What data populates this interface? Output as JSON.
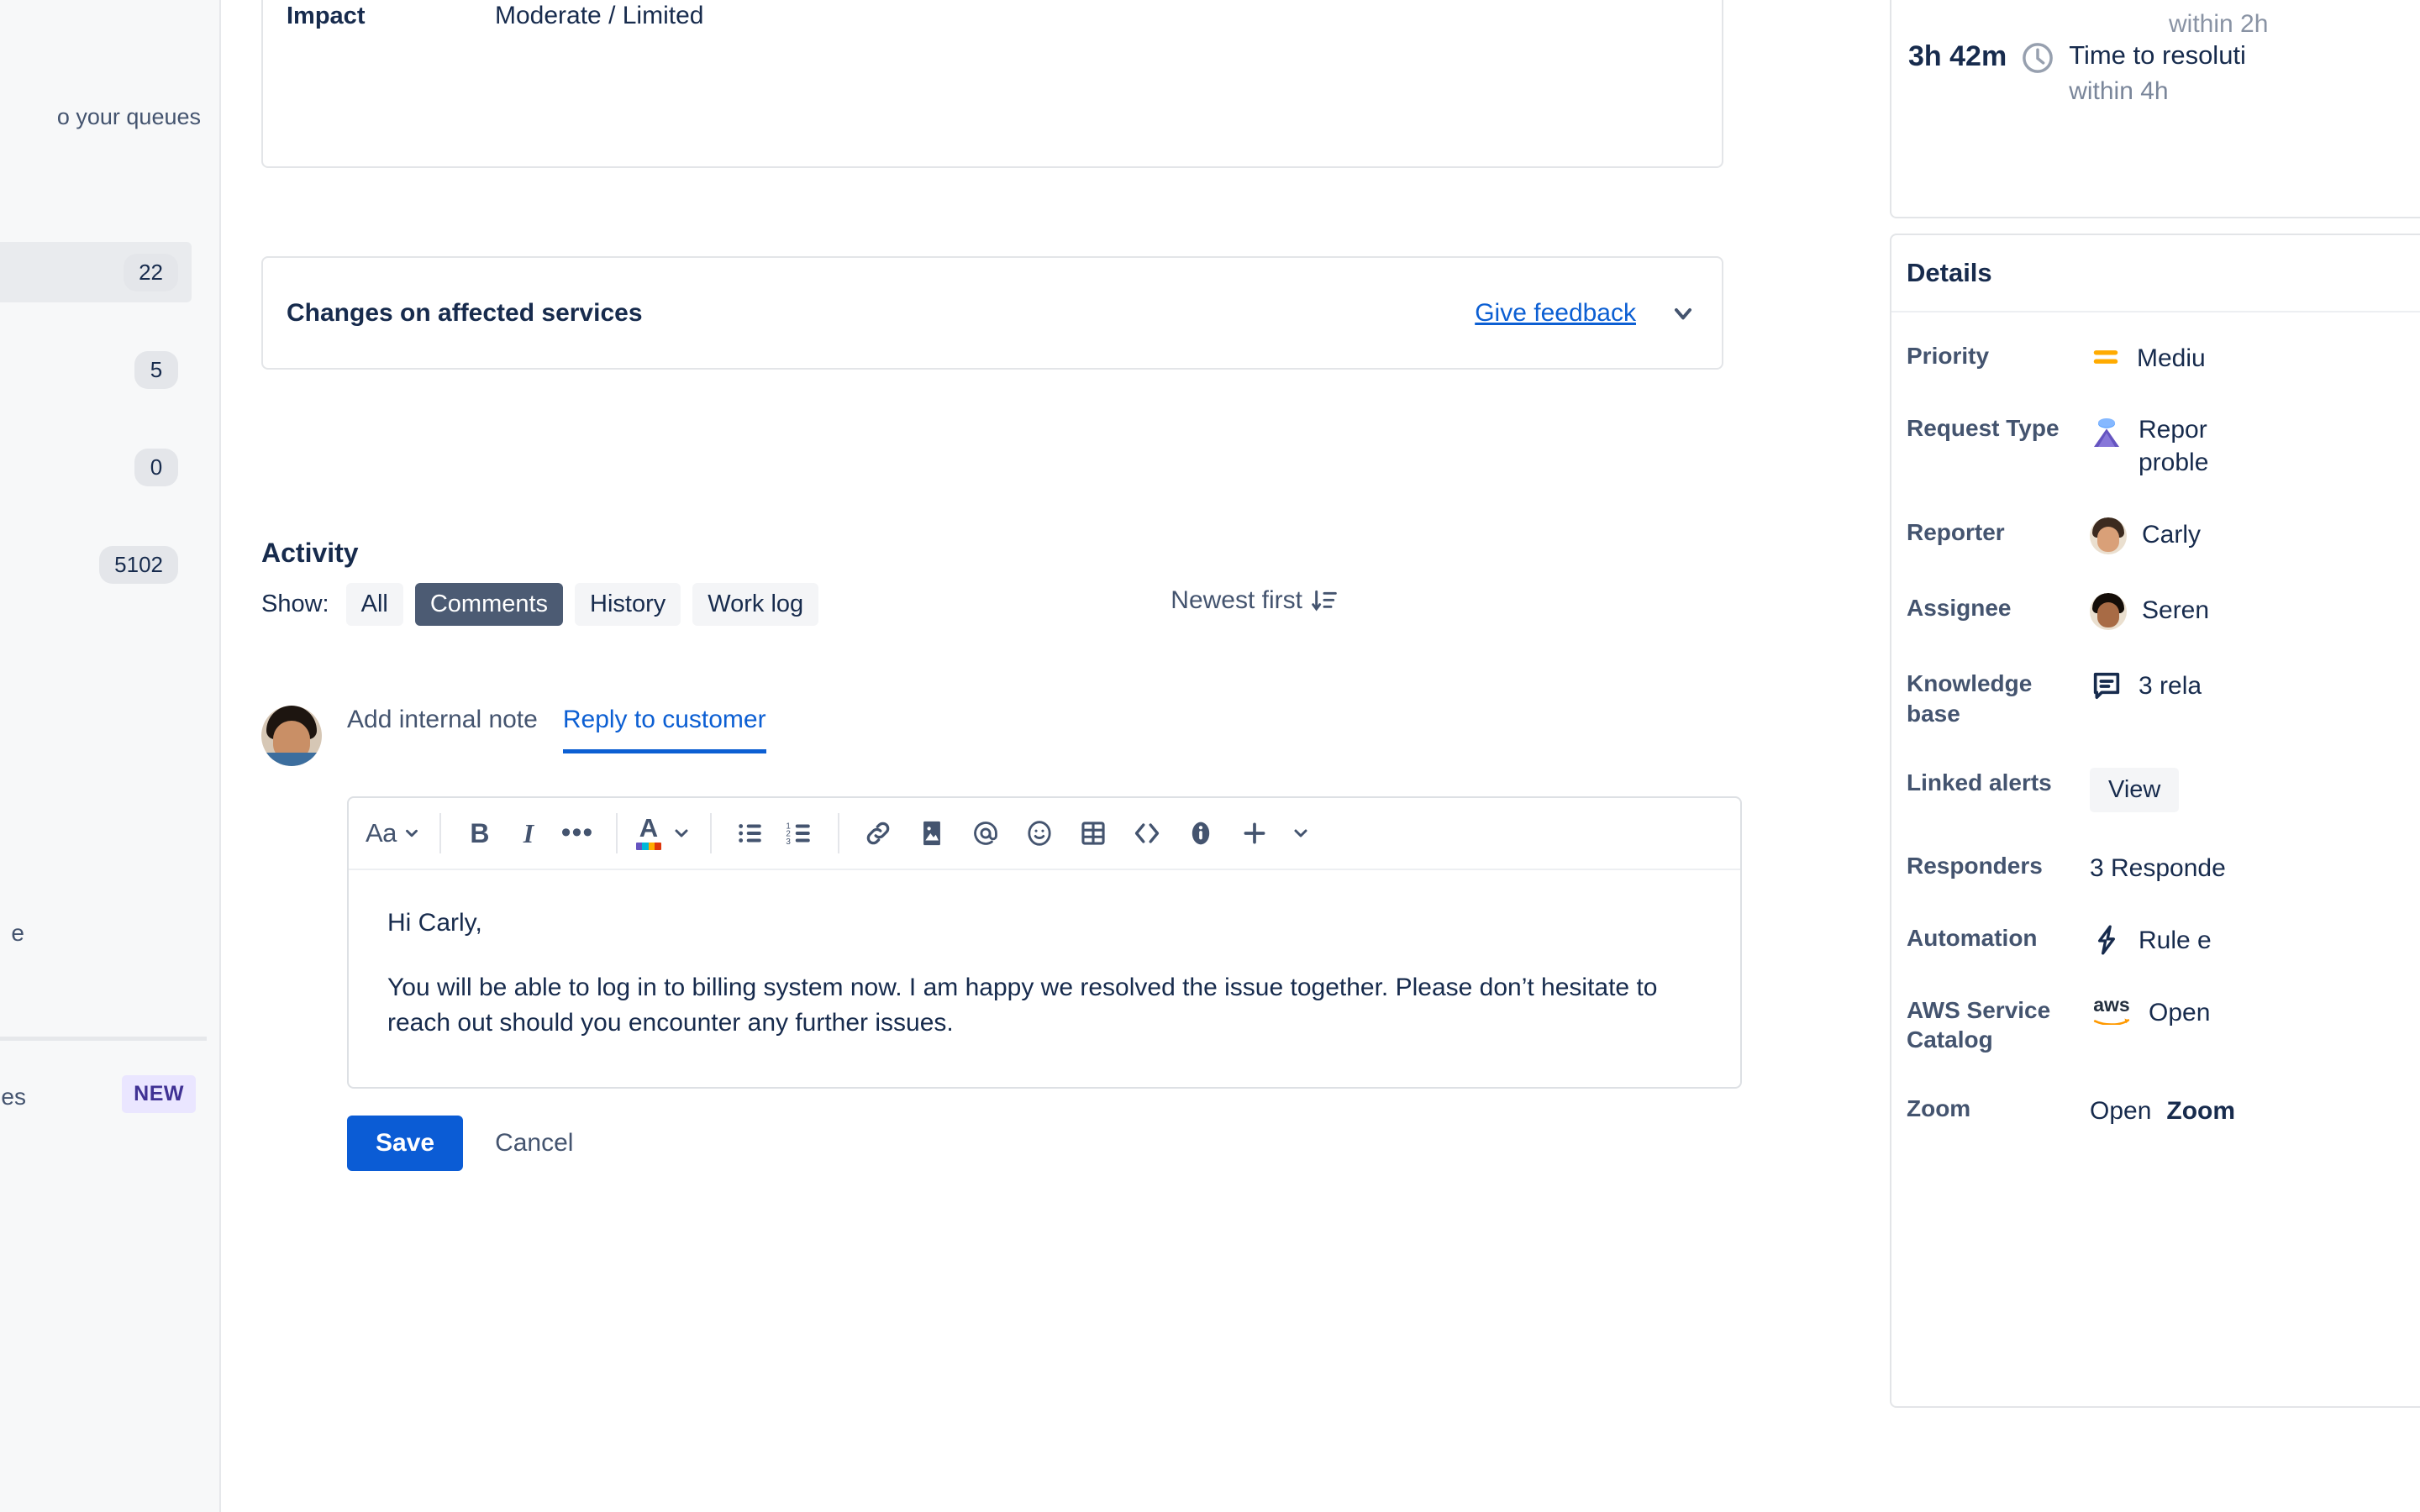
{
  "sidebar": {
    "queues_text": "o your queues",
    "items": [
      {
        "badge": "22",
        "selected": true
      },
      {
        "badge": "5",
        "selected": false
      },
      {
        "badge": "0",
        "selected": false
      },
      {
        "badge": "5102",
        "selected": false
      }
    ],
    "partial_label_1": "e",
    "partial_label_2": "es",
    "new_badge": "NEW"
  },
  "impact_card": {
    "label": "Impact",
    "value": "Moderate / Limited"
  },
  "changes_card": {
    "title": "Changes on affected services",
    "feedback_link": "Give feedback"
  },
  "activity": {
    "title": "Activity",
    "show_label": "Show:",
    "filters": [
      {
        "label": "All",
        "active": false
      },
      {
        "label": "Comments",
        "active": true
      },
      {
        "label": "History",
        "active": false
      },
      {
        "label": "Work log",
        "active": false
      }
    ],
    "sort_label": "Newest first"
  },
  "composer": {
    "tabs": [
      {
        "label": "Add internal note",
        "active": false
      },
      {
        "label": "Reply to customer",
        "active": true
      }
    ],
    "toolbar": {
      "text_style": "Aa",
      "bold": "B",
      "italic": "I",
      "more": "•••",
      "text_color": "A",
      "icons": [
        "bulleted-list-icon",
        "numbered-list-icon",
        "link-icon",
        "image-icon",
        "mention-icon",
        "emoji-icon",
        "table-icon",
        "code-icon",
        "info-icon",
        "plus-icon",
        "chevron-down-icon"
      ]
    },
    "body": {
      "greeting": "Hi Carly,",
      "paragraph": "You will be able to log in to billing system now. I am happy we resolved the issue together. Please don’t hesitate to reach out should you encounter any further issues."
    },
    "save_label": "Save",
    "cancel_label": "Cancel"
  },
  "sla": {
    "clipped_top": "within 2h",
    "time": "3h 42m",
    "line1": "Time to resoluti",
    "line2": "within 4h"
  },
  "details": {
    "title": "Details",
    "rows": [
      {
        "key": "Priority",
        "icon": "priority-medium-icon",
        "value": "Mediu"
      },
      {
        "key": "Request Type",
        "icon": "report-problem-icon",
        "value": "Repor",
        "value2": "proble"
      },
      {
        "key": "Reporter",
        "icon": "avatar",
        "value": "Carly"
      },
      {
        "key": "Assignee",
        "icon": "avatar-dark",
        "value": "Seren"
      },
      {
        "key": "Knowledge base",
        "icon": "knowledge-base-icon",
        "value": "3 rela"
      },
      {
        "key": "Linked alerts",
        "icon": "button",
        "value": "View"
      },
      {
        "key": "Responders",
        "icon": "none",
        "value": "3 Responde"
      },
      {
        "key": "Automation",
        "icon": "lightning-icon",
        "value": "Rule e"
      },
      {
        "key": "AWS Service Catalog",
        "icon": "aws-icon",
        "value": "Open"
      },
      {
        "key": "Zoom",
        "icon": "none",
        "value": "Open ",
        "value_bold": "Zoom"
      }
    ]
  },
  "colors": {
    "link": "#0C5FD3",
    "primary_button": "#0B5CD5",
    "chip_active": "#4C5B73",
    "priority_medium": "#FFAB00",
    "new_badge_bg": "#EAE6FF",
    "new_badge_text": "#403294"
  }
}
